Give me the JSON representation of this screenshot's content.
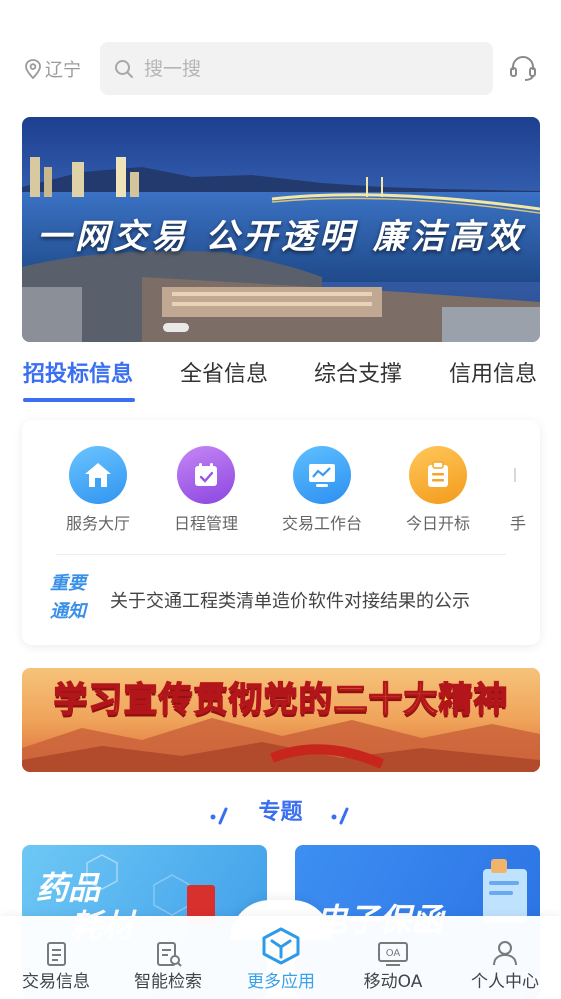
{
  "header": {
    "location": "辽宁",
    "search_placeholder": "搜一搜"
  },
  "banner": {
    "slogan": "一网交易 公开透明 廉洁高效"
  },
  "tabs": [
    {
      "label": "招投标信息",
      "active": true
    },
    {
      "label": "全省信息",
      "active": false
    },
    {
      "label": "综合支撑",
      "active": false
    },
    {
      "label": "信用信息",
      "active": false
    }
  ],
  "apps": [
    {
      "label": "服务大厅",
      "icon": "home-icon",
      "color": "#3fa9f5"
    },
    {
      "label": "日程管理",
      "icon": "calendar-icon",
      "color": "#a05ce8"
    },
    {
      "label": "交易工作台",
      "icon": "monitor-icon",
      "color": "#3a9cf0"
    },
    {
      "label": "今日开标",
      "icon": "clipboard-icon",
      "color": "#f6a623"
    },
    {
      "label": "手",
      "icon": "partial-icon",
      "color": "#c9c9c9"
    }
  ],
  "notice": {
    "tag_line1": "重要",
    "tag_line2": "通知",
    "text": "关于交通工程类清单造价软件对接结果的公示"
  },
  "promo": {
    "text": "学习宣传贯彻党的二十大精神"
  },
  "topics": {
    "title": "专题",
    "cards": [
      {
        "text_line1": "药品",
        "text_line2": "耗材"
      },
      {
        "text_line1": "电子保函"
      }
    ]
  },
  "bottom_nav": [
    {
      "label": "交易信息",
      "icon": "document-icon",
      "active": false
    },
    {
      "label": "智能检索",
      "icon": "search-doc-icon",
      "active": false
    },
    {
      "label": "更多应用",
      "icon": "cube-icon",
      "active": true
    },
    {
      "label": "移动OA",
      "icon": "oa-icon",
      "active": false
    },
    {
      "label": "个人中心",
      "icon": "user-icon",
      "active": false
    }
  ],
  "colors": {
    "accent": "#3a6ff2",
    "nav_active": "#3aa0e8"
  }
}
